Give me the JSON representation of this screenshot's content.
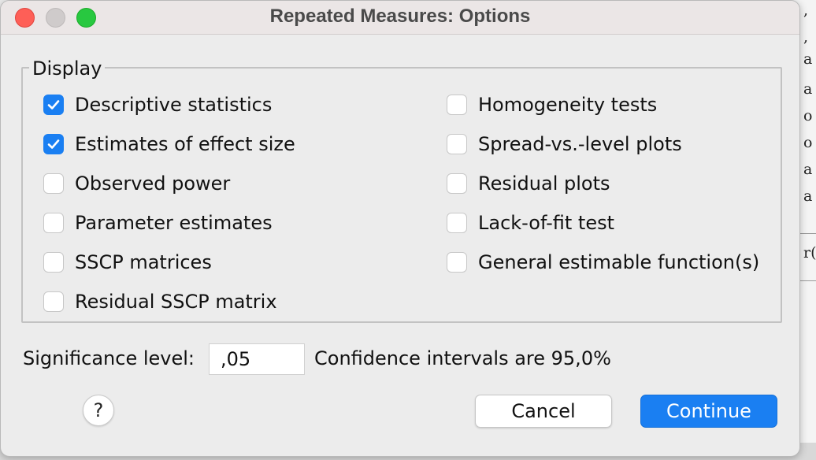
{
  "window": {
    "title": "Repeated Measures: Options"
  },
  "display_group": {
    "title": "Display",
    "left_options": [
      {
        "label": "Descriptive statistics",
        "checked": true
      },
      {
        "label": "Estimates of effect size",
        "checked": true
      },
      {
        "label": "Observed power",
        "checked": false
      },
      {
        "label": "Parameter estimates",
        "checked": false
      },
      {
        "label": "SSCP matrices",
        "checked": false
      },
      {
        "label": "Residual SSCP matrix",
        "checked": false
      }
    ],
    "right_options": [
      {
        "label": "Homogeneity tests",
        "checked": false
      },
      {
        "label": "Spread-vs.-level plots",
        "checked": false
      },
      {
        "label": "Residual plots",
        "checked": false
      },
      {
        "label": "Lack-of-fit test",
        "checked": false
      },
      {
        "label": "General estimable function(s)",
        "checked": false
      }
    ]
  },
  "significance": {
    "label": "Significance level:",
    "value": ",05",
    "confidence_text": "Confidence intervals are 95,0%"
  },
  "buttons": {
    "help": "?",
    "cancel": "Cancel",
    "continue": "Continue"
  },
  "background_app": {
    "lines": [
      ",",
      ",",
      "a",
      "a",
      "o",
      "o",
      "a",
      "a",
      "r("
    ]
  },
  "colors": {
    "accent": "#1a7ff2",
    "close": "#fe5f57",
    "maximize": "#28c840"
  }
}
